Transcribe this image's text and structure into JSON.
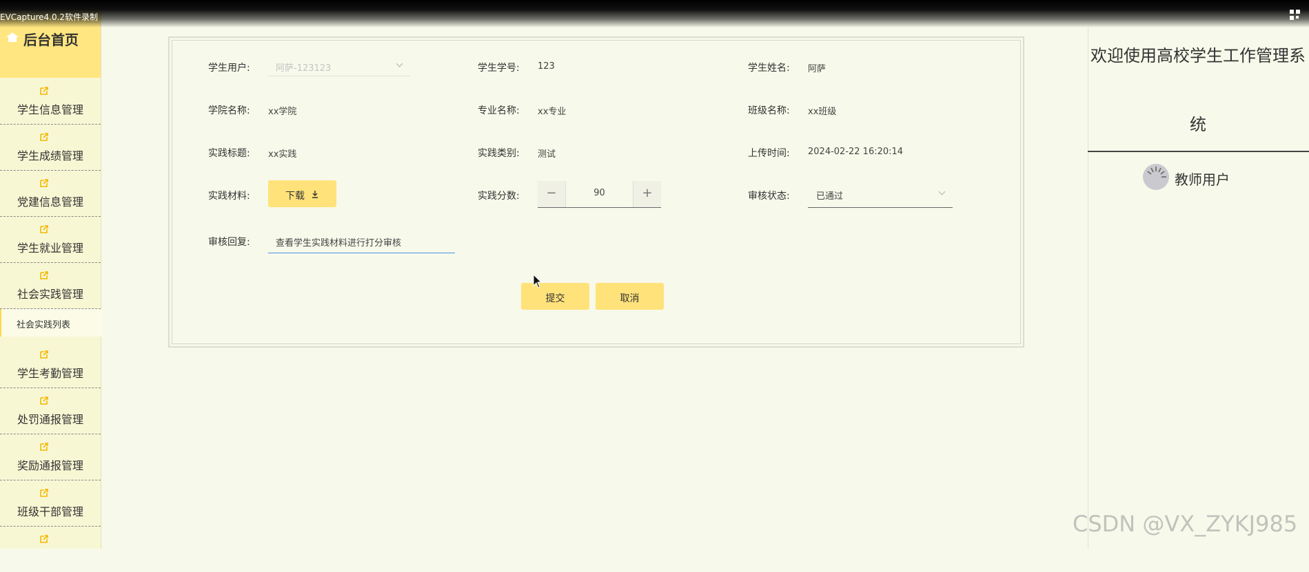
{
  "recorder": {
    "label": "EVCapture4.0.2软件录制"
  },
  "sidebar": {
    "home_label": "后台首页",
    "items": [
      {
        "label": "学生信息管理"
      },
      {
        "label": "学生成绩管理"
      },
      {
        "label": "党建信息管理"
      },
      {
        "label": "学生就业管理"
      },
      {
        "label": "社会实践管理"
      },
      {
        "label": "学生考勤管理"
      },
      {
        "label": "处罚通报管理"
      },
      {
        "label": "奖励通报管理"
      },
      {
        "label": "班级干部管理"
      },
      {
        "label": ""
      }
    ],
    "active_sub_item": "社会实践列表"
  },
  "form": {
    "student_user": {
      "label": "学生用户:",
      "value": "阿萨-123123"
    },
    "student_no": {
      "label": "学生学号:",
      "value": "123"
    },
    "student_name": {
      "label": "学生姓名:",
      "value": "阿萨"
    },
    "college": {
      "label": "学院名称:",
      "value": "xx学院"
    },
    "major": {
      "label": "专业名称:",
      "value": "xx专业"
    },
    "class_name": {
      "label": "班级名称:",
      "value": "xx班级"
    },
    "practice_title": {
      "label": "实践标题:",
      "value": "xx实践"
    },
    "practice_type": {
      "label": "实践类别:",
      "value": "测试"
    },
    "upload_time": {
      "label": "上传时间:",
      "value": "2024-02-22 16:20:14"
    },
    "practice_material": {
      "label": "实践材料:",
      "button": "下载"
    },
    "practice_score": {
      "label": "实践分数:",
      "value": "90",
      "minus": "−",
      "plus": "+"
    },
    "review_status": {
      "label": "审核状态:",
      "value": "已通过"
    },
    "review_reply": {
      "label": "审核回复:",
      "value": "查看学生实践材料进行打分审核"
    },
    "submit_label": "提交",
    "cancel_label": "取消"
  },
  "right_panel": {
    "welcome_line1": "欢迎使用高校学生工作管理系",
    "welcome_line2": "统",
    "user_role": "教师用户"
  },
  "watermark": "CSDN @VX_ZYKJ985",
  "colors": {
    "accent": "#ffe27a",
    "background": "#f7f9ea",
    "sidebar": "#f8f7d4",
    "home": "#ffe680"
  }
}
